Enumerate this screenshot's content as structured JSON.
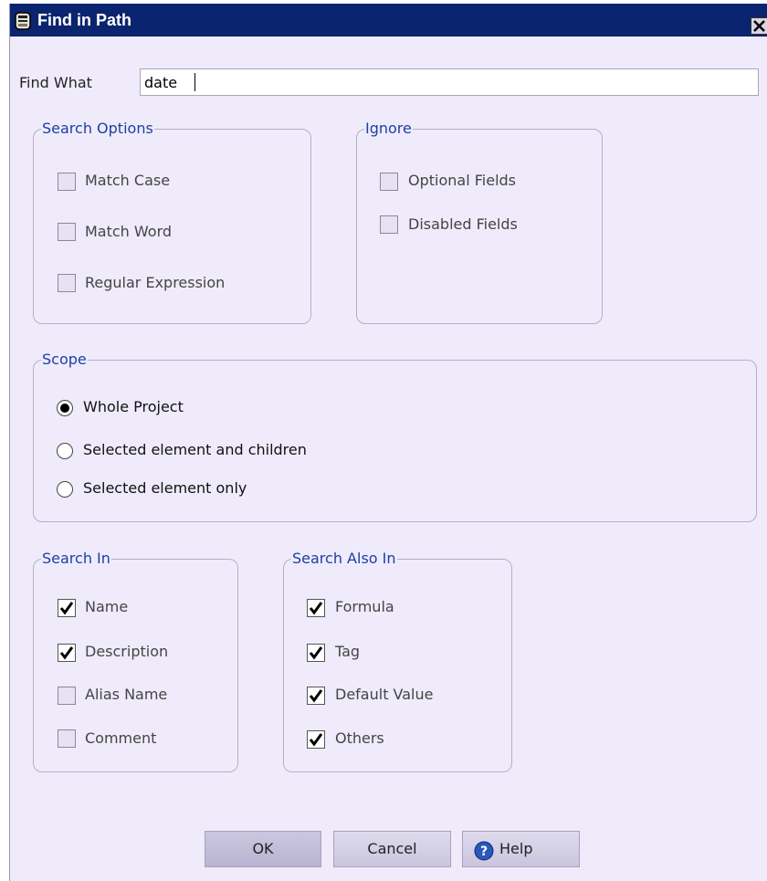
{
  "window": {
    "title": "Find in Path"
  },
  "find": {
    "label": "Find What",
    "value": "date"
  },
  "search_options": {
    "legend": "Search Options",
    "items": [
      {
        "label": "Match Case",
        "checked": false
      },
      {
        "label": "Match Word",
        "checked": false
      },
      {
        "label": "Regular Expression",
        "checked": false
      }
    ]
  },
  "ignore": {
    "legend": "Ignore",
    "items": [
      {
        "label": "Optional Fields",
        "checked": false
      },
      {
        "label": "Disabled Fields",
        "checked": false
      }
    ]
  },
  "scope": {
    "legend": "Scope",
    "options": [
      {
        "label": "Whole Project",
        "selected": true
      },
      {
        "label": "Selected element and children",
        "selected": false
      },
      {
        "label": "Selected element only",
        "selected": false
      }
    ]
  },
  "search_in": {
    "legend": "Search In",
    "items": [
      {
        "label": "Name",
        "checked": true
      },
      {
        "label": "Description",
        "checked": true
      },
      {
        "label": "Alias Name",
        "checked": false
      },
      {
        "label": "Comment",
        "checked": false
      }
    ]
  },
  "search_also_in": {
    "legend": "Search Also In",
    "items": [
      {
        "label": "Formula",
        "checked": true
      },
      {
        "label": "Tag",
        "checked": true
      },
      {
        "label": "Default Value",
        "checked": true
      },
      {
        "label": "Others",
        "checked": true
      }
    ]
  },
  "buttons": {
    "ok": "OK",
    "cancel": "Cancel",
    "help": "Help"
  },
  "colors": {
    "titlebar": "#0b2470",
    "dialog_bg": "#efebfb",
    "legend": "#1d3fa6"
  },
  "icons": {
    "window": "dialog-icon",
    "close": "close-icon",
    "help": "help-icon"
  }
}
